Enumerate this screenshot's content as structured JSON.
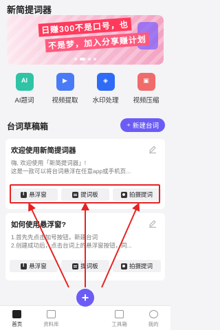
{
  "app": {
    "title": "新简提词器"
  },
  "banner": {
    "line1": "日赚300不是口号，也",
    "line2": "不是梦，加入分享赚计划"
  },
  "tools": [
    {
      "label": "AI题词",
      "icon": "ai-icon",
      "color": "#2ec4a5",
      "glyph": "AI"
    },
    {
      "label": "视频提取",
      "icon": "video-extract-icon",
      "color": "#4a7bf7",
      "glyph": "▶"
    },
    {
      "label": "水印处理",
      "icon": "watermark-icon",
      "color": "#2f6bf5",
      "glyph": "◈"
    },
    {
      "label": "视频压缩",
      "icon": "video-compress-icon",
      "color": "#f06b6b",
      "glyph": "▣"
    }
  ],
  "drafts": {
    "title": "台词草稿箱",
    "new_button": "新建台词",
    "items": [
      {
        "title": "欢迎使用新简提词器",
        "line1": "嗨, 欢迎使用「新简提词器」!",
        "line2": "这是一款可以将台词悬浮在任意app或手机页..."
      },
      {
        "title": "如何使用悬浮窗?",
        "line1": "1.首先先点击加号按钮，新建台词",
        "line2": "2.创建成功后，点击台词上的悬浮窗按钮，同..."
      }
    ],
    "actions": {
      "float": "悬浮窗",
      "board": "提词板",
      "record": "拍摄提词"
    }
  },
  "tabbar": {
    "home": "首页",
    "library": "资料库",
    "toolbox": "工具箱",
    "mine": "我的"
  },
  "colors": {
    "accent": "#6b5cf6",
    "highlight": "#e52222"
  }
}
